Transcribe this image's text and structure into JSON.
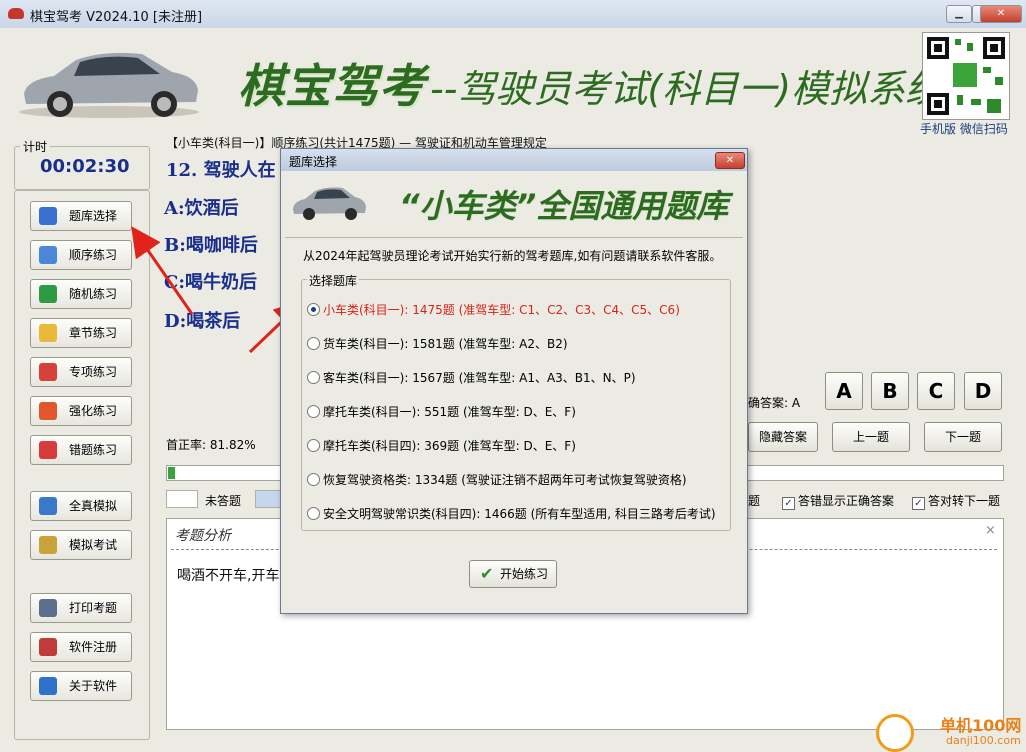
{
  "window": {
    "title": "棋宝驾考 V2024.10 [未注册]",
    "min": "▁",
    "max": "□",
    "close": "✕"
  },
  "banner": {
    "title": "棋宝驾考",
    "subtitle": "--驾驶员考试(科目一)模拟系统",
    "qr_label": "手机版 微信扫码"
  },
  "timer": {
    "legend": "计时",
    "value": "00:02:30"
  },
  "nav": {
    "items": [
      {
        "label": "题库选择",
        "icon": "blocks-icon",
        "color": "#3b6fd1"
      },
      {
        "label": "顺序练习",
        "icon": "pencil-icon",
        "color": "#4a86d9"
      },
      {
        "label": "随机练习",
        "icon": "refresh-icon",
        "color": "#2f9a44"
      },
      {
        "label": "章节练习",
        "icon": "note-icon",
        "color": "#e8b93a"
      },
      {
        "label": "专项练习",
        "icon": "checklist-icon",
        "color": "#d8403a"
      },
      {
        "label": "强化练习",
        "icon": "chart-icon",
        "color": "#e0562f"
      },
      {
        "label": "错题练习",
        "icon": "flag-icon",
        "color": "#d83a3a"
      },
      {
        "label": "全真模拟",
        "icon": "grid-icon",
        "color": "#3a78c9"
      },
      {
        "label": "模拟考试",
        "icon": "calendar-icon",
        "color": "#c8a23a"
      },
      {
        "label": "打印考题",
        "icon": "printer-icon",
        "color": "#5a6f8c"
      },
      {
        "label": "软件注册",
        "icon": "pen-icon",
        "color": "#c23a3a"
      },
      {
        "label": "关于软件",
        "icon": "info-icon",
        "color": "#2f72c9"
      }
    ]
  },
  "question": {
    "header": "【小车类(科目一)】顺序练习(共计1475题) — 驾驶证和机动车管理规定",
    "text": "12. 驾驶人在",
    "options": [
      "A:饮酒后",
      "B:喝咖啡后",
      "C:喝牛奶后",
      "D:喝茶后"
    ],
    "correct_label": "确答案: A"
  },
  "answer_buttons": [
    "A",
    "B",
    "C",
    "D"
  ],
  "actions": {
    "hide_answer": "隐藏答案",
    "prev": "上一题",
    "next": "下一题"
  },
  "stats": {
    "accuracy": "首正率: 81.82%",
    "progress": 0.008
  },
  "legend": {
    "unanswered": "未答题"
  },
  "options_checks": [
    {
      "label": "题",
      "checked": false
    },
    {
      "label": "答错显示正确答案",
      "checked": true
    },
    {
      "label": "答对转下一题",
      "checked": true
    }
  ],
  "analysis": {
    "title": "考题分析",
    "body": "喝酒不开车,开车",
    "close": "×"
  },
  "dialog": {
    "title": "题库选择",
    "close": "✕",
    "banner": "“小车类”全国通用题库",
    "notice": "从2024年起驾驶员理论考试开始实行新的驾考题库,如有问题请联系软件客服。",
    "group_legend": "选择题库",
    "banks": [
      {
        "label": "小车类(科目一): 1475题 (准驾车型: C1、C2、C3、C4、C5、C6)",
        "selected": true
      },
      {
        "label": "货车类(科目一): 1581题 (准驾车型: A2、B2)",
        "selected": false
      },
      {
        "label": "客车类(科目一): 1567题 (准驾车型: A1、A3、B1、N、P)",
        "selected": false
      },
      {
        "label": "摩托车类(科目一): 551题 (准驾车型: D、E、F)",
        "selected": false
      },
      {
        "label": "摩托车类(科目四): 369题 (准驾车型: D、E、F)",
        "selected": false
      },
      {
        "label": "恢复驾驶资格类: 1334题 (驾驶证注销不超两年可考试恢复驾驶资格)",
        "selected": false
      },
      {
        "label": "安全文明驾驶常识类(科目四): 1466题 (所有车型适用, 科目三路考后考试)",
        "selected": false
      }
    ],
    "start": "开始练习"
  },
  "watermark": {
    "text": "单机100网",
    "url": "danji100.com"
  },
  "colors": {
    "accent_green": "#2d6b21",
    "question_blue": "#1a2f8c",
    "selected_red": "#d8231a"
  }
}
